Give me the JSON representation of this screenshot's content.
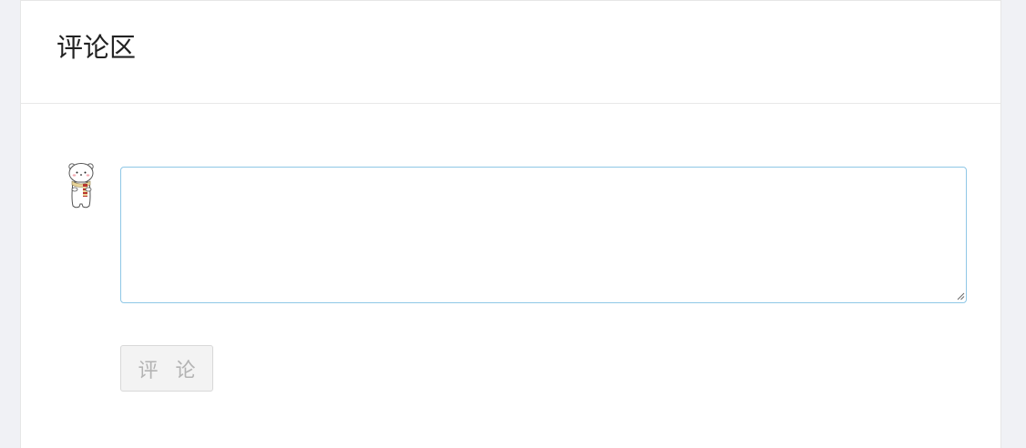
{
  "comments": {
    "title": "评论区",
    "input": {
      "value": "",
      "placeholder": ""
    },
    "submit_label": "评 论",
    "avatar_icon": "polar-bear-avatar-icon"
  },
  "colors": {
    "page_background": "#f0f1f5",
    "card_background": "#ffffff",
    "input_border": "#8fc7e6",
    "button_disabled_bg": "#f3f3f3",
    "button_disabled_text": "#b3b3b3"
  }
}
